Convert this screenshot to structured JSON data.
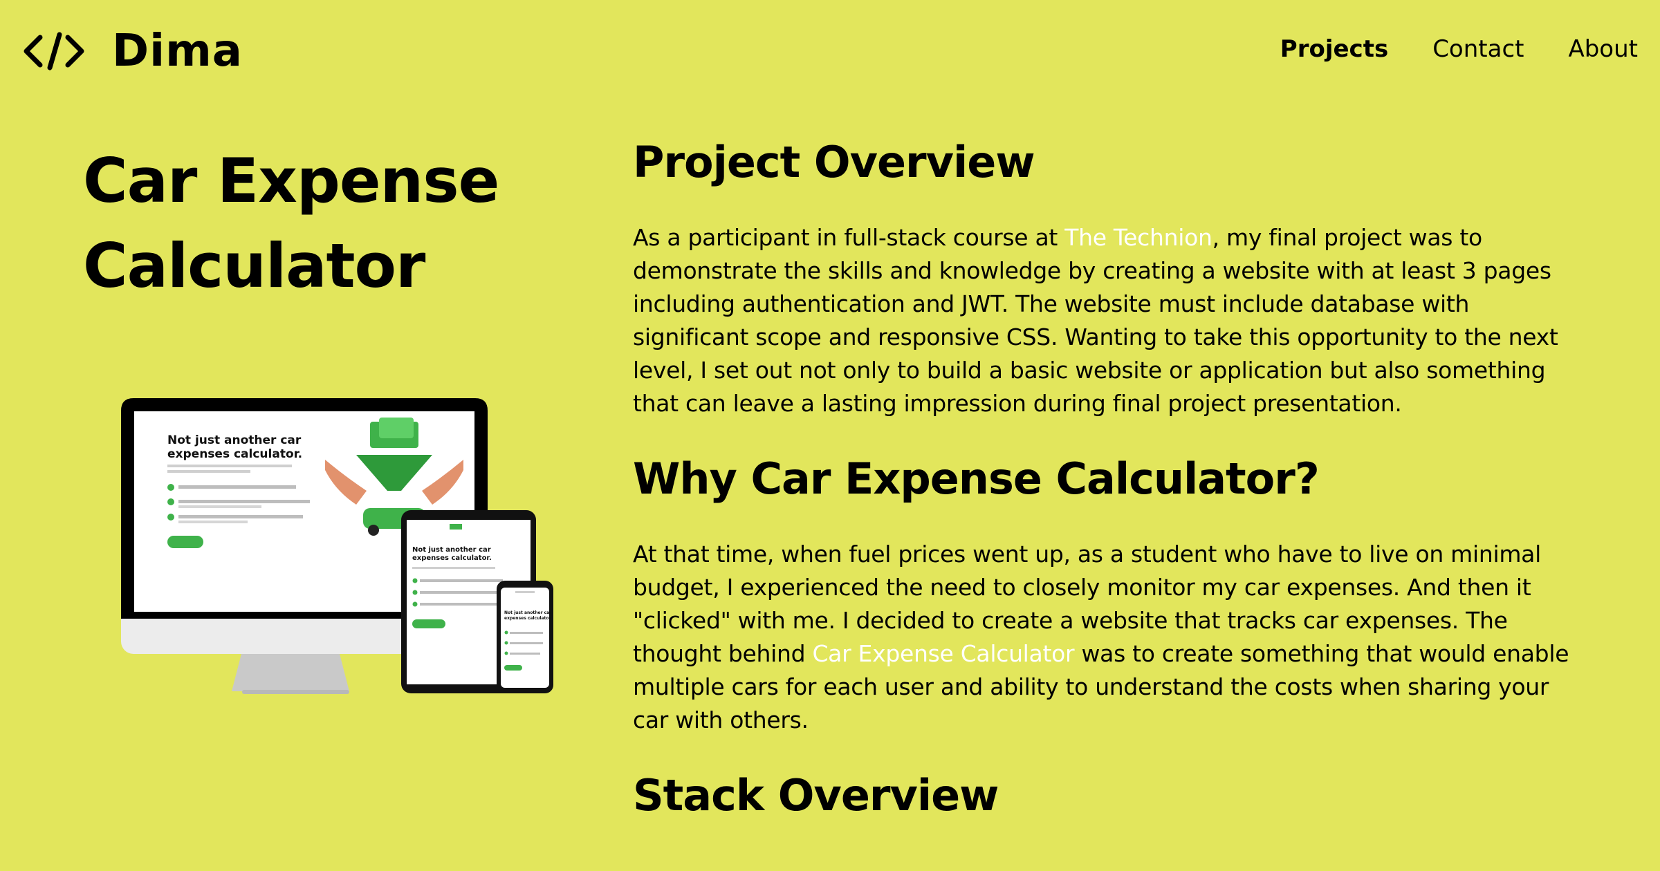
{
  "header": {
    "logo_text": "Dima",
    "nav": [
      {
        "label": "Projects",
        "active": true
      },
      {
        "label": "Contact",
        "active": false
      },
      {
        "label": "About",
        "active": false
      }
    ]
  },
  "project": {
    "title_line1": "Car Expense",
    "title_line2": "Calculator"
  },
  "mockup": {
    "desktop_heading_line1": "Not just another car",
    "desktop_heading_line2": "expenses calculator.",
    "tablet_heading_line1": "Not just another car",
    "tablet_heading_line2": "expenses calculator.",
    "phone_heading_line1": "Not just another car",
    "phone_heading_line2": "expenses calculator."
  },
  "sections": {
    "overview": {
      "heading": "Project Overview",
      "text_before": "As a participant in full-stack course at ",
      "link": "The Technion",
      "text_after": ", my final project was to demonstrate the skills and knowledge by creating a website with at least 3 pages including authentication and JWT. The website must include database with significant scope and responsive CSS. Wanting to take this opportunity to the next level, I set out not only to build a basic website or application but also something that can leave a lasting impression during final project presentation."
    },
    "why": {
      "heading": "Why Car Expense Calculator?",
      "text_before": "At that time, when fuel prices went up, as a student who have to live on minimal budget, I experienced the need to closely monitor my car expenses. And then it \"clicked\" with me. I decided to create a website that tracks car expenses. The thought behind ",
      "link": "Car Expense Calculator",
      "text_after": " was to create something that would enable multiple cars for each user and ability to understand the costs when sharing your car with others."
    },
    "stack": {
      "heading": "Stack Overview"
    }
  },
  "colors": {
    "background": "#e2e65c",
    "text": "#000000",
    "link": "#ffffff",
    "accent_green": "#3fb24a"
  }
}
